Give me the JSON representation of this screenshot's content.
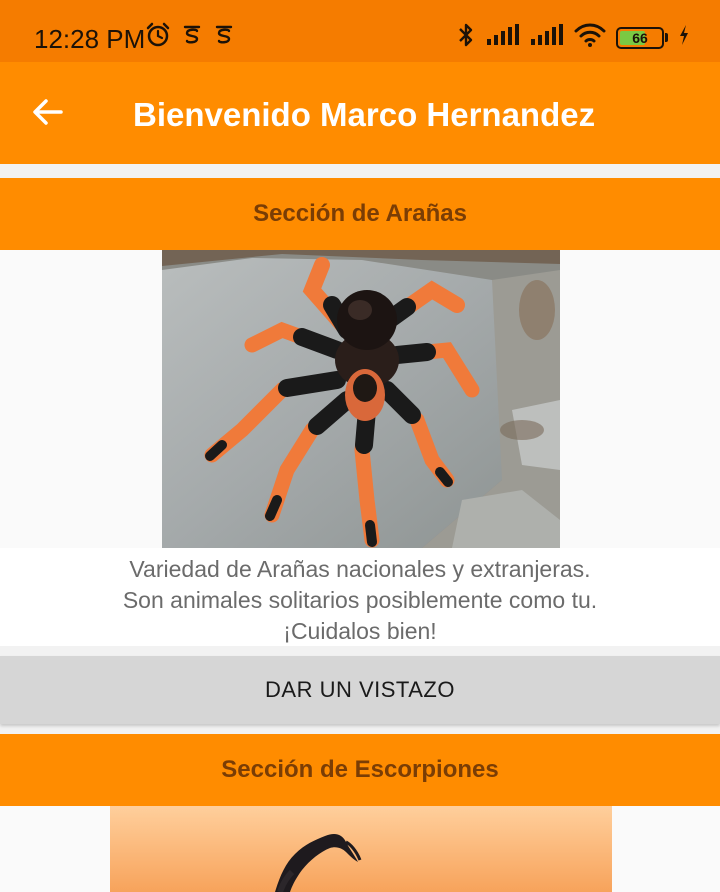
{
  "status_bar": {
    "time": "12:28 PM",
    "icons_left": [
      "alarm-icon",
      "notification-icon",
      "notification-icon"
    ],
    "icons_right": [
      "bluetooth-icon",
      "signal-icon",
      "signal-icon",
      "wifi-icon",
      "battery-icon",
      "charging-icon"
    ],
    "battery_level": "66",
    "battery_color": "#7ac943",
    "background_color": "#f57c00"
  },
  "app_bar": {
    "title": "Bienvenido Marco Hernandez",
    "back_icon": "arrow-back-icon",
    "background_color": "#ff8c00"
  },
  "sections": [
    {
      "title": "Sección de Arañas",
      "description_lines": [
        "Variedad de Arañas nacionales y extranjeras.",
        "Son animales solitarios posiblemente como tu.",
        "¡Cuidalos bien!"
      ],
      "button_label": "DAR UN VISTAZO"
    },
    {
      "title": "Sección de Escorpiones"
    }
  ]
}
